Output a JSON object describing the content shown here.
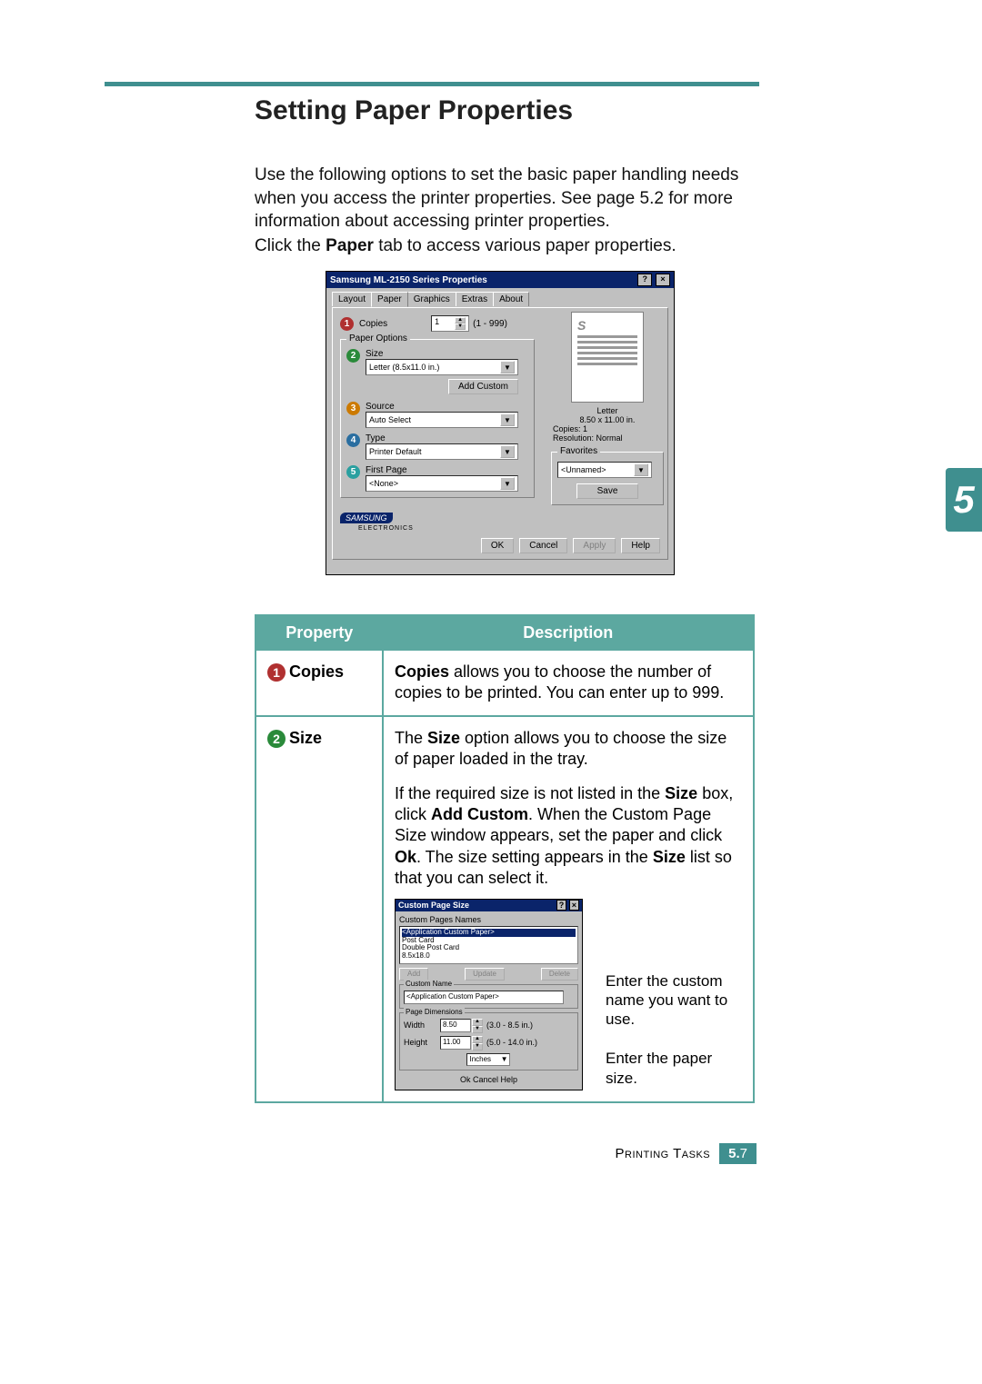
{
  "page": {
    "heading": "Setting Paper Properties",
    "intro": "Use the following options to set the basic paper handling needs when you access the printer properties. See page 5.2 for more information about accessing printer properties.",
    "click_line_pre": "Click the ",
    "click_line_bold": "Paper",
    "click_line_post": " tab to access various paper properties.",
    "chapter_tab": "5",
    "footer_section": "Printing Tasks",
    "footer_page_bold": "5.",
    "footer_page_num": "7"
  },
  "dialog": {
    "title": "Samsung ML-2150 Series Properties",
    "help_btn": "?",
    "close_btn": "×",
    "tabs": [
      "Layout",
      "Paper",
      "Graphics",
      "Extras",
      "About"
    ],
    "active_tab": "Paper",
    "copies": {
      "label": "Copies",
      "value": "1",
      "range": "(1 - 999)"
    },
    "paper_options_label": "Paper Options",
    "size": {
      "label": "Size",
      "value": "Letter (8.5x11.0 in.)",
      "add_custom": "Add Custom"
    },
    "source": {
      "label": "Source",
      "value": "Auto Select"
    },
    "type": {
      "label": "Type",
      "value": "Printer Default"
    },
    "first_page": {
      "label": "First Page",
      "value": "<None>"
    },
    "preview": {
      "size_line1": "Letter",
      "size_line2": "8.50 x 11.00 in.",
      "copies": "Copies: 1",
      "resolution": "Resolution: Normal"
    },
    "favorites": {
      "label": "Favorites",
      "value": "<Unnamed>",
      "save": "Save"
    },
    "brand": "SAMSUNG",
    "brand_sub": "ELECTRONICS",
    "buttons": {
      "ok": "OK",
      "cancel": "Cancel",
      "apply": "Apply",
      "help": "Help"
    }
  },
  "table": {
    "header_property": "Property",
    "header_description": "Description",
    "rows": [
      {
        "num": "1",
        "name": "Copies",
        "desc_html": "<b>Copies</b> allows you to choose the number of copies to be printed. You can enter up to 999."
      },
      {
        "num": "2",
        "name": "Size",
        "desc_html1": "The <b>Size</b> option allows you to choose the size of paper loaded in the tray.",
        "desc_html2": "If the required size is not listed in the <b>Size</b> box, click <b>Add Custom</b>. When the Custom Page Size window appears, set the paper and click <b>Ok</b>. The size setting appears in the <b>Size</b> list so that you can select it."
      }
    ]
  },
  "custom_dialog": {
    "title": "Custom Page Size",
    "names_label": "Custom Pages Names",
    "list": [
      "<Application Custom Paper>",
      "Post Card",
      "Double Post Card",
      "8.5x18.0"
    ],
    "btn_add": "Add",
    "btn_update": "Update",
    "btn_delete": "Delete",
    "custom_name_label": "Custom Name",
    "custom_name_value": "<Application Custom Paper>",
    "dims_label": "Page Dimensions",
    "width_label": "Width",
    "width_value": "8.50",
    "width_range": "(3.0 - 8.5 in.)",
    "height_label": "Height",
    "height_value": "11.00",
    "height_range": "(5.0 - 14.0 in.)",
    "units": "Inches",
    "ok": "Ok",
    "cancel": "Cancel",
    "help": "Help"
  },
  "annotations": {
    "name": "Enter the custom name you want to use.",
    "size": "Enter the paper size."
  }
}
